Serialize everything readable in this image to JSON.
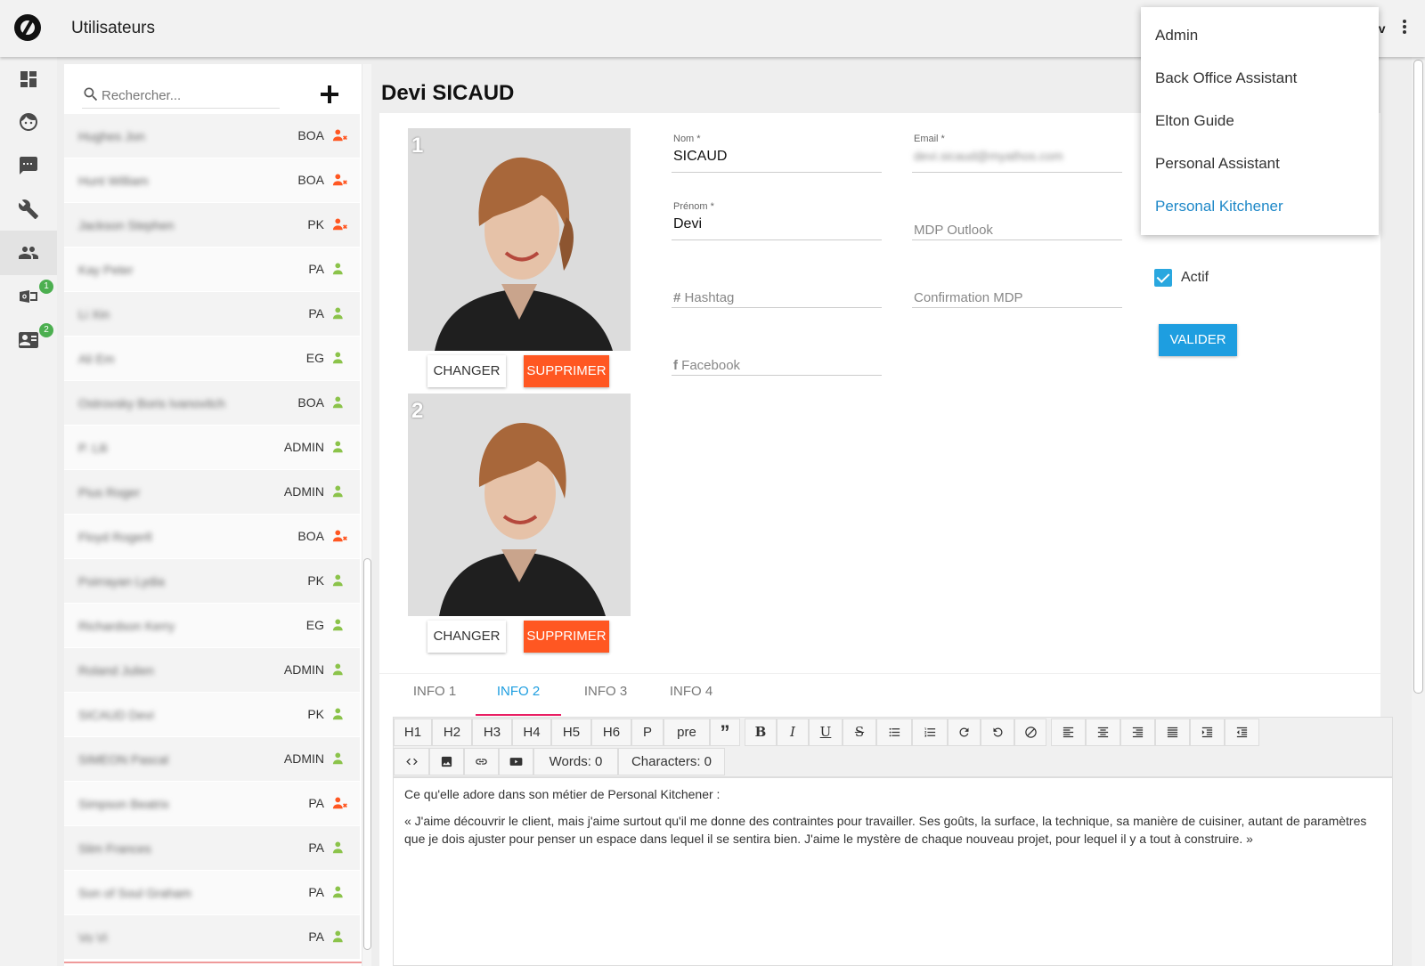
{
  "header": {
    "title": "Utilisateurs",
    "user_partial": "ev"
  },
  "nav": {
    "items": [
      {
        "name": "dashboard"
      },
      {
        "name": "profile"
      },
      {
        "name": "chat"
      },
      {
        "name": "tools"
      },
      {
        "name": "users"
      },
      {
        "name": "outlook",
        "badge": "1"
      },
      {
        "name": "contacts",
        "badge": "2"
      }
    ]
  },
  "search": {
    "placeholder": "Rechercher..."
  },
  "users": [
    {
      "name": "Hughes Jon",
      "role": "BOA",
      "active": false
    },
    {
      "name": "Hunt William",
      "role": "BOA",
      "active": false
    },
    {
      "name": "Jackson Stephen",
      "role": "PK",
      "active": false
    },
    {
      "name": "Kay Peter",
      "role": "PA",
      "active": true
    },
    {
      "name": "Li Xin",
      "role": "PA",
      "active": true
    },
    {
      "name": "Ali Em",
      "role": "EG",
      "active": true
    },
    {
      "name": "Ostrovsky Boris Ivanovitch",
      "role": "BOA",
      "active": true
    },
    {
      "name": "P. Lili",
      "role": "ADMIN",
      "active": true
    },
    {
      "name": "Pius Roger",
      "role": "ADMIN",
      "active": true
    },
    {
      "name": "Floyd Rogerll",
      "role": "BOA",
      "active": false
    },
    {
      "name": "Poirrayan Lydia",
      "role": "PK",
      "active": true
    },
    {
      "name": "Richardson Kerry",
      "role": "EG",
      "active": true
    },
    {
      "name": "Roland Julien",
      "role": "ADMIN",
      "active": true
    },
    {
      "name": "SICAUD Devi",
      "role": "PK",
      "active": true
    },
    {
      "name": "SIMEON Pascal",
      "role": "ADMIN",
      "active": true
    },
    {
      "name": "Simpson Beatrix",
      "role": "PA",
      "active": false
    },
    {
      "name": "Slim Frances",
      "role": "PA",
      "active": true
    },
    {
      "name": "Son of Soul Graham",
      "role": "PA",
      "active": true
    },
    {
      "name": "Vo Vi",
      "role": "PA",
      "active": true
    }
  ],
  "detail": {
    "title": "Devi SICAUD",
    "photos": [
      {
        "number": "1"
      },
      {
        "number": "2"
      }
    ],
    "change_label": "CHANGER",
    "delete_label": "SUPPRIMER",
    "fields": {
      "nom": {
        "label": "Nom *",
        "value": "SICAUD"
      },
      "prenom": {
        "label": "Prénom *",
        "value": "Devi"
      },
      "email": {
        "label": "Email *",
        "value": "devi.sicaud@myathos.com"
      },
      "mdp_outlook": {
        "placeholder": "MDP Outlook"
      },
      "hashtag": {
        "placeholder": "Hashtag"
      },
      "confirmation": {
        "placeholder": "Confirmation MDP"
      },
      "facebook": {
        "placeholder": "Facebook"
      }
    },
    "actif_label": "Actif",
    "actif_checked": true,
    "valider_label": "VALIDER"
  },
  "tabs": [
    {
      "label": "INFO 1",
      "active": false
    },
    {
      "label": "INFO 2",
      "active": true
    },
    {
      "label": "INFO 3",
      "active": false
    },
    {
      "label": "INFO 4",
      "active": false
    }
  ],
  "toolbar": {
    "headings": [
      "H1",
      "H2",
      "H3",
      "H4",
      "H5",
      "H6",
      "P",
      "pre"
    ],
    "words": "Words: 0",
    "characters": "Characters: 0"
  },
  "editor": {
    "line1": "Ce qu'elle adore dans son métier de Personal Kitchener :",
    "line2": "« J'aime découvrir le client, mais j'aime surtout qu'il me donne des contraintes pour travailler. Ses goûts, la surface, la technique, sa manière de cuisiner, autant de paramètres que je dois ajuster pour penser un espace dans lequel il se sentira bien. J'aime le mystère de chaque nouveau projet, pour lequel il y a tout à construire. »"
  },
  "dropdown": {
    "options": [
      "Admin",
      "Back Office Assistant",
      "Elton Guide",
      "Personal Assistant",
      "Personal Kitchener"
    ],
    "selected": "Personal Kitchener"
  },
  "colors": {
    "accent": "#1e9ee0",
    "danger": "#ff5722",
    "active_user": "#8bc34a",
    "inactive_user": "#ff5722",
    "tab_ink": "#e91e63"
  }
}
